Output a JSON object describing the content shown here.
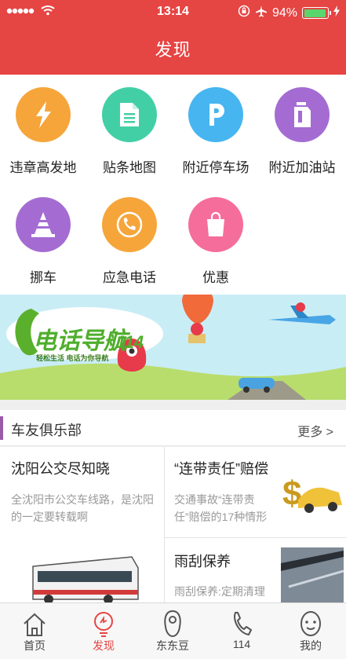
{
  "status": {
    "time": "13:14",
    "battery": "94%",
    "battery_level": 0.94
  },
  "header": {
    "title": "发现"
  },
  "features": [
    {
      "label": "违章高发地",
      "icon": "lightning-icon",
      "color": "#f6a53b"
    },
    {
      "label": "贴条地图",
      "icon": "document-icon",
      "color": "#43cfa6"
    },
    {
      "label": "附近停车场",
      "icon": "parking-icon",
      "color": "#47b5f0"
    },
    {
      "label": "附近加油站",
      "icon": "fuel-can-icon",
      "color": "#a46cd2"
    },
    {
      "label": "挪车",
      "icon": "traffic-cone-icon",
      "color": "#a46cd2"
    },
    {
      "label": "应急电话",
      "icon": "phone-icon",
      "color": "#f6a53b"
    },
    {
      "label": "优惠",
      "icon": "shopping-bag-icon",
      "color": "#f56d9b"
    }
  ],
  "banner": {
    "text": "电话导航",
    "number": "114",
    "slogan": "轻松生活  电话为你导航"
  },
  "club": {
    "title": "车友俱乐部",
    "more": "更多 >"
  },
  "news": [
    {
      "title": "沈阳公交尽知晓",
      "desc": "全沈阳市公交车线路，是沈阳的一定要转载啊"
    },
    {
      "title": "“连带责任”赔偿",
      "desc": "交通事故“连带责任”赔偿的17种情形"
    },
    {
      "title": "雨刮保养",
      "desc": "雨刮保养:定期清理"
    }
  ],
  "tabs": [
    {
      "label": "首页",
      "icon": "home-icon",
      "active": false
    },
    {
      "label": "发现",
      "icon": "discover-bulb-icon",
      "active": true
    },
    {
      "label": "东东豆",
      "icon": "bean-icon",
      "active": false
    },
    {
      "label": "114",
      "icon": "phone-icon",
      "active": false
    },
    {
      "label": "我的",
      "icon": "profile-face-icon",
      "active": false
    }
  ],
  "colors": {
    "brand": "#e54543",
    "club_accent": "#9b5aa7"
  }
}
